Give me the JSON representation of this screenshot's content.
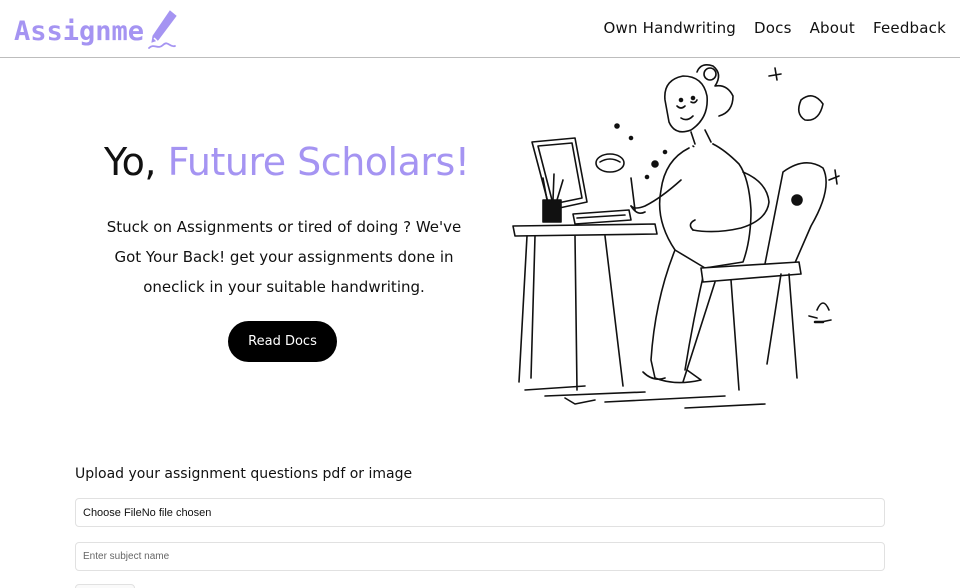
{
  "header": {
    "logo_text": "Assignme",
    "nav": [
      "Own Handwriting",
      "Docs",
      "About",
      "Feedback"
    ]
  },
  "hero": {
    "title_prefix": "Yo,",
    "title_accent": "Future Scholars!",
    "subtitle": "Stuck on Assignments or tired of doing ? We've Got Your Back! get your assignments done in oneclick in your suitable handwriting.",
    "button_label": "Read Docs"
  },
  "upload": {
    "label": "Upload your assignment questions pdf or image",
    "file_button": "Choose File",
    "file_status": "No file chosen",
    "subject_placeholder": "Enter subject name"
  },
  "colors": {
    "accent": "#a594f2",
    "button_bg": "#000000"
  },
  "icons": [
    "pen-icon",
    "illustration-student-at-desk"
  ]
}
